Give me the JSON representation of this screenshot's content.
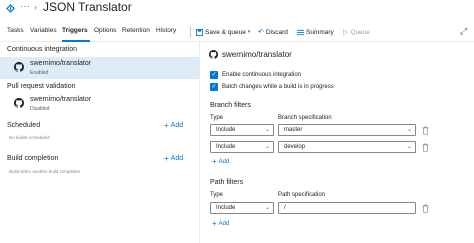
{
  "header": {
    "ellipsis": "···",
    "chevron": "›",
    "title": "JSON Translator"
  },
  "tabs": [
    {
      "label": "Tasks"
    },
    {
      "label": "Variables"
    },
    {
      "label": "Triggers",
      "active": true
    },
    {
      "label": "Options"
    },
    {
      "label": "Retention"
    },
    {
      "label": "History"
    }
  ],
  "toolbar": {
    "save_label": "Save & queue",
    "discard_label": "Discard",
    "summary_label": "Summary",
    "queue_label": "Queue"
  },
  "left": {
    "ci_title": "Continuous integration",
    "ci_item": {
      "name": "swernimo/translator",
      "status": "Enabled"
    },
    "pr_title": "Pull request validation",
    "pr_item": {
      "name": "swernimo/translator",
      "status": "Disabled"
    },
    "scheduled_title": "Scheduled",
    "scheduled_note": "No builds scheduled",
    "completion_title": "Build completion",
    "completion_note": "Build when another build completes",
    "add_label": "Add"
  },
  "right": {
    "repo_name": "swernimo/translator",
    "enable_ci_label": "Enable continuous integration",
    "batch_label": "Batch changes while a build is in progress",
    "branch_filters_title": "Branch filters",
    "type_label": "Type",
    "branch_spec_label": "Branch specification",
    "branch_filters": [
      {
        "type": "Include",
        "spec": "master"
      },
      {
        "type": "Include",
        "spec": "develop"
      }
    ],
    "add_label": "Add",
    "path_filters_title": "Path filters",
    "path_spec_label": "Path specification",
    "path_filters": [
      {
        "type": "Include",
        "spec": "/"
      }
    ]
  },
  "colors": {
    "accent": "#0078d4",
    "selected_bg": "#deecf9"
  }
}
